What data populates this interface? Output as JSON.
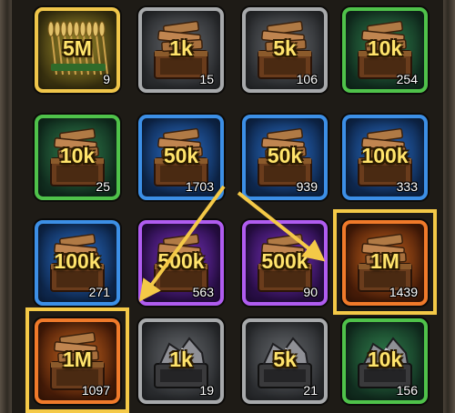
{
  "colors": {
    "highlight": "#f4c947",
    "amount_text": "#ffe46b",
    "rarity_gray": "#a7a9ab",
    "rarity_green": "#4fc24a",
    "rarity_blue": "#3c8fe6",
    "rarity_purple": "#b05cf0",
    "rarity_orange": "#f07a2a",
    "rarity_gold": "#f0c64a"
  },
  "inventory": {
    "items": [
      {
        "amount": "5M",
        "qty": "9",
        "rarity": "gold",
        "icon": "wheat-bundle-icon",
        "highlighted": false
      },
      {
        "amount": "1k",
        "qty": "15",
        "rarity": "gray",
        "icon": "wood-crate-icon",
        "highlighted": false
      },
      {
        "amount": "5k",
        "qty": "106",
        "rarity": "gray",
        "icon": "wood-crate-icon",
        "highlighted": false
      },
      {
        "amount": "10k",
        "qty": "254",
        "rarity": "green",
        "icon": "wood-crate-icon",
        "highlighted": false
      },
      {
        "amount": "10k",
        "qty": "25",
        "rarity": "green",
        "icon": "wood-crate-icon",
        "highlighted": false
      },
      {
        "amount": "50k",
        "qty": "1703",
        "rarity": "blue",
        "icon": "wood-crate-icon",
        "highlighted": false
      },
      {
        "amount": "50k",
        "qty": "939",
        "rarity": "blue",
        "icon": "wood-crate-icon",
        "highlighted": false
      },
      {
        "amount": "100k",
        "qty": "333",
        "rarity": "blue",
        "icon": "wood-crate-icon",
        "highlighted": false
      },
      {
        "amount": "100k",
        "qty": "271",
        "rarity": "blue",
        "icon": "wood-crate-icon",
        "highlighted": false
      },
      {
        "amount": "500k",
        "qty": "563",
        "rarity": "purple",
        "icon": "wood-crate-icon",
        "highlighted": false
      },
      {
        "amount": "500k",
        "qty": "90",
        "rarity": "purple",
        "icon": "wood-crate-icon",
        "highlighted": false
      },
      {
        "amount": "1M",
        "qty": "1439",
        "rarity": "orange",
        "icon": "wood-crate-icon",
        "highlighted": true
      },
      {
        "amount": "1M",
        "qty": "1097",
        "rarity": "orange",
        "icon": "wood-crate-icon",
        "highlighted": true
      },
      {
        "amount": "1k",
        "qty": "19",
        "rarity": "gray",
        "icon": "ore-cart-icon",
        "highlighted": false
      },
      {
        "amount": "5k",
        "qty": "21",
        "rarity": "gray",
        "icon": "ore-cart-icon",
        "highlighted": false
      },
      {
        "amount": "10k",
        "qty": "156",
        "rarity": "green",
        "icon": "ore-cart-icon",
        "highlighted": false
      }
    ]
  }
}
